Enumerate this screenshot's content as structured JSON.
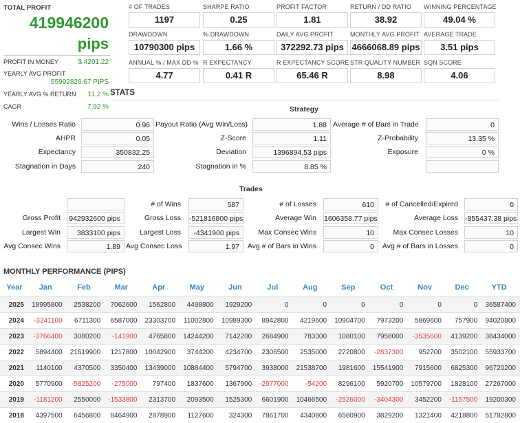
{
  "summary": {
    "total_profit_label": "TOTAL PROFIT",
    "total_profit_value": "419946200",
    "total_profit_unit": "pips",
    "profit_money_label": "PROFIT IN MONEY",
    "profit_money_value": "$ 4201.22",
    "yearly_avg_profit_label": "YEARLY AVG PROFIT",
    "yearly_avg_profit_value": "55992826.67 PIPS",
    "yearly_avg_return_label": "YEARLY AVG % RETURN",
    "yearly_avg_return_value": "11.2 %",
    "cagr_label": "CAGR",
    "cagr_value": "7.92 %"
  },
  "metrics": [
    {
      "label": "# OF TRADES",
      "value": "1197"
    },
    {
      "label": "SHARPE RATIO",
      "value": "0.25"
    },
    {
      "label": "PROFIT FACTOR",
      "value": "1.81"
    },
    {
      "label": "RETURN / DD RATIO",
      "value": "38.92"
    },
    {
      "label": "WINNING PERCENTAGE",
      "value": "49.04 %"
    },
    {
      "label": "DRAWDOWN",
      "value": "10790300 pips"
    },
    {
      "label": "% DRAWDOWN",
      "value": "1.66 %"
    },
    {
      "label": "DAILY AVG PROFIT",
      "value": "372292.73 pips"
    },
    {
      "label": "MONTHLY AVG PROFIT",
      "value": "4666068.89 pips"
    },
    {
      "label": "AVERAGE TRADE",
      "value": "3.51 pips"
    },
    {
      "label": "ANNUAL % / MAX DD %",
      "value": "4.77"
    },
    {
      "label": "R EXPECTANCY",
      "value": "0.41 R"
    },
    {
      "label": "R EXPECTANCY SCORE",
      "value": "65.46 R"
    },
    {
      "label": "STR QUALITY NUMBER",
      "value": "8.98"
    },
    {
      "label": "SQN SCORE",
      "value": "4.06"
    }
  ],
  "stats": {
    "title": "STATS",
    "strategy_heading": "Strategy",
    "strategy_rows": [
      [
        {
          "label": "Wins / Losses Ratio",
          "value": "0.96"
        },
        {
          "label": "Payout Ratio (Avg Win/Loss)",
          "value": "1.88"
        },
        {
          "label": "Average # of Bars in Trade",
          "value": "0"
        }
      ],
      [
        {
          "label": "AHPR",
          "value": "0.05"
        },
        {
          "label": "Z-Score",
          "value": "1.11"
        },
        {
          "label": "Z-Probability",
          "value": "13.35 %"
        }
      ],
      [
        {
          "label": "Expectancy",
          "value": "350832.25"
        },
        {
          "label": "Deviation",
          "value": "1396894.53 pips"
        },
        {
          "label": "Exposure",
          "value": "0 %"
        }
      ],
      [
        {
          "label": "Stagnation in Days",
          "value": "240"
        },
        {
          "label": "Stagnation in %",
          "value": "8.85 %"
        },
        {
          "label": "",
          "value": ""
        }
      ]
    ],
    "trades_heading": "Trades",
    "trades_rows": [
      [
        {
          "label": "",
          "value": ""
        },
        {
          "label": "# of Wins",
          "value": "587"
        },
        {
          "label": "# of Losses",
          "value": "610"
        },
        {
          "label": "# of Cancelled/Expired",
          "value": "0"
        }
      ],
      [
        {
          "label": "Gross Profit",
          "value": "942932600 pips"
        },
        {
          "label": "Gross Loss",
          "value": "-521816800 pips"
        },
        {
          "label": "Average Win",
          "value": "1606358.77 pips"
        },
        {
          "label": "Average Loss",
          "value": "-855437.38 pips"
        }
      ],
      [
        {
          "label": "Largest Win",
          "value": "3833100 pips"
        },
        {
          "label": "Largest Loss",
          "value": "-4341900 pips"
        },
        {
          "label": "Max Consec Wins",
          "value": "10"
        },
        {
          "label": "Max Consec Losses",
          "value": "10"
        }
      ],
      [
        {
          "label": "Avg Consec Wins",
          "value": "1.89"
        },
        {
          "label": "Avg Consec Loss",
          "value": "1.97"
        },
        {
          "label": "Avg # of Bars in Wins",
          "value": "0"
        },
        {
          "label": "Avg # of Bars in Losses",
          "value": "0"
        }
      ]
    ]
  },
  "monthly": {
    "title": "MONTHLY PERFORMANCE (PIPS)",
    "headers": [
      "Year",
      "Jan",
      "Feb",
      "Mar",
      "Apr",
      "May",
      "Jun",
      "Jul",
      "Aug",
      "Sep",
      "Oct",
      "Nov",
      "Dec",
      "YTD"
    ],
    "rows": [
      [
        "2025",
        "18995800",
        "2538200",
        "7062600",
        "1562800",
        "4498800",
        "1929200",
        "0",
        "0",
        "0",
        "0",
        "0",
        "0",
        "36587400"
      ],
      [
        "2024",
        "-3241100",
        "6711300",
        "6587000",
        "23303700",
        "11002800",
        "10989300",
        "8942800",
        "4219600",
        "10904700",
        "7973200",
        "5869600",
        "757900",
        "94020800"
      ],
      [
        "2023",
        "-3766400",
        "3080200",
        "-141900",
        "4765800",
        "14244200",
        "7142200",
        "2684900",
        "783300",
        "1080100",
        "7958000",
        "-3535600",
        "4139200",
        "38434000"
      ],
      [
        "2022",
        "5894400",
        "21619900",
        "1217800",
        "10042900",
        "3744200",
        "4234700",
        "2306500",
        "2535000",
        "2720800",
        "-2837300",
        "952700",
        "3502100",
        "55933700"
      ],
      [
        "2021",
        "1140100",
        "4370500",
        "3350400",
        "13439000",
        "10884400",
        "5794700",
        "3938000",
        "21538700",
        "1981600",
        "15541900",
        "7915600",
        "6825300",
        "96720200"
      ],
      [
        "2020",
        "5770900",
        "-5825200",
        "-275000",
        "797400",
        "1837600",
        "1367900",
        "-2977000",
        "-54200",
        "8296100",
        "5920700",
        "10579700",
        "1828100",
        "27267000"
      ],
      [
        "2019",
        "-1181200",
        "2550000",
        "-1533800",
        "2313700",
        "2093500",
        "1525300",
        "6601900",
        "10466500",
        "-2526000",
        "-3404300",
        "3452200",
        "-1157500",
        "19200300"
      ],
      [
        "2018",
        "4397500",
        "6456800",
        "8464900",
        "2878900",
        "1127600",
        "324300",
        "7861700",
        "4340800",
        "6560900",
        "3829200",
        "1321400",
        "4218800",
        "51782800"
      ]
    ]
  }
}
